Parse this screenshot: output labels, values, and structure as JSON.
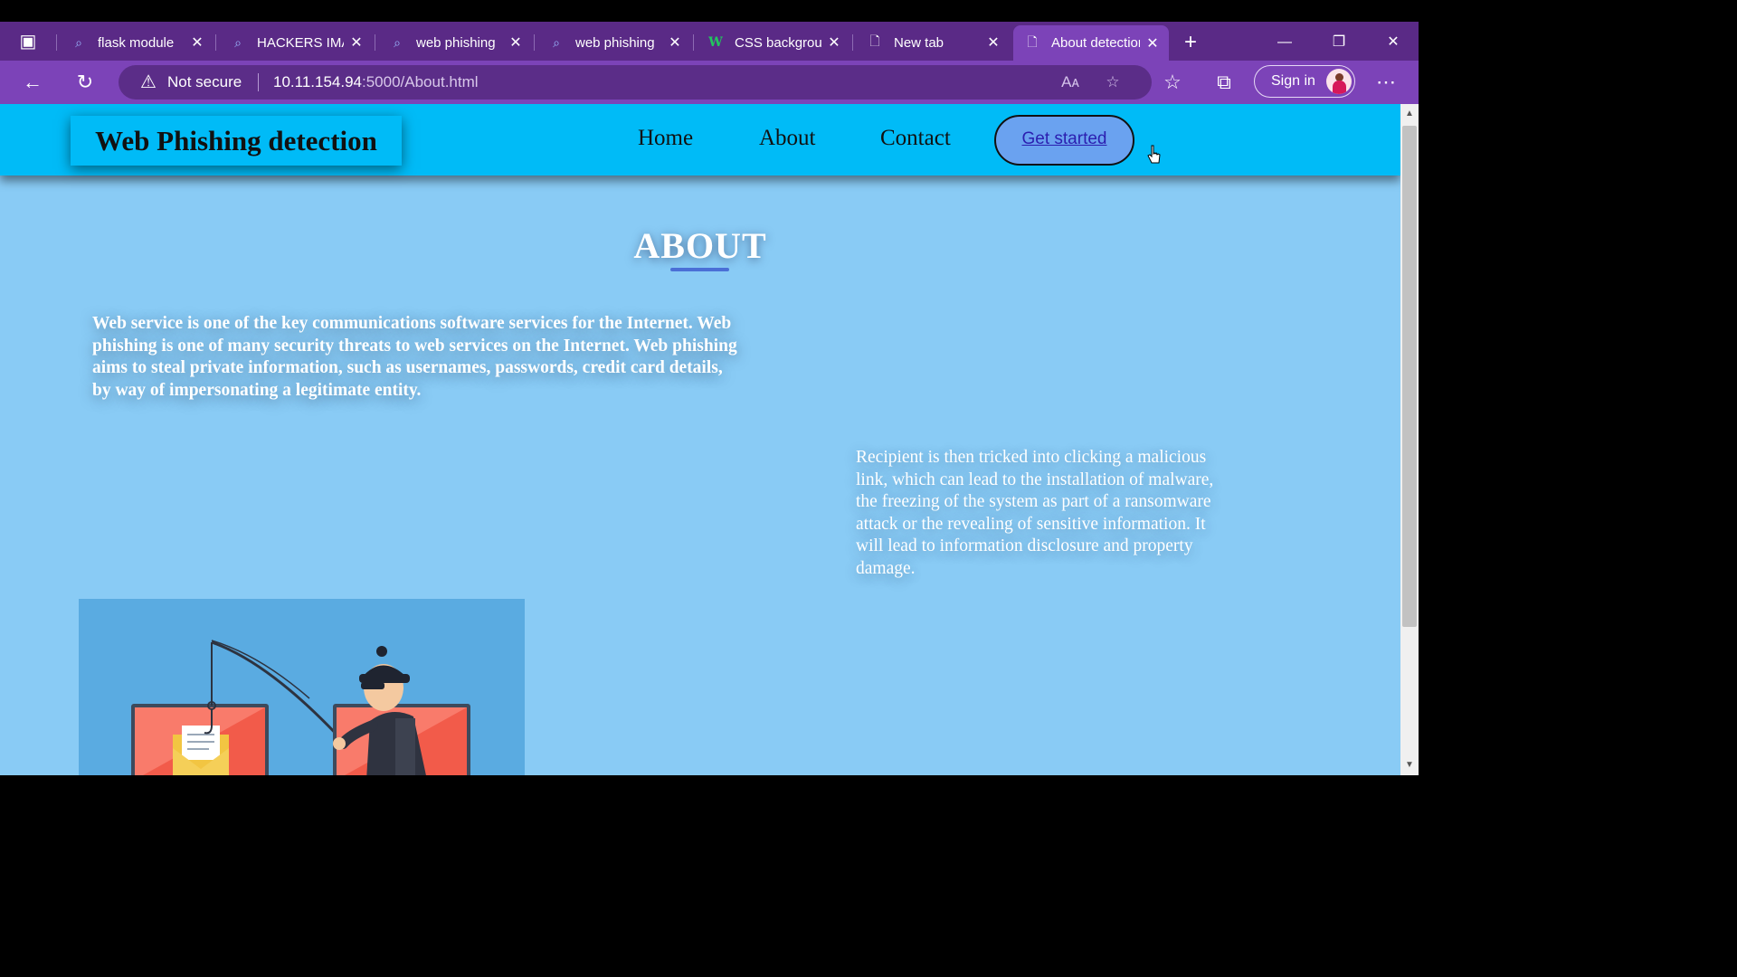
{
  "browser": {
    "tabs": [
      {
        "label": "flask module",
        "icon": "search-icon"
      },
      {
        "label": "HACKERS IMAGES",
        "icon": "search-icon"
      },
      {
        "label": "web phishing",
        "icon": "search-icon"
      },
      {
        "label": "web phishing",
        "icon": "search-icon"
      },
      {
        "label": "CSS background",
        "icon": "w3schools-icon"
      },
      {
        "label": "New tab",
        "icon": "document-icon"
      },
      {
        "label": "About detection",
        "icon": "document-icon",
        "active": true
      }
    ],
    "address": {
      "security_label": "Not secure",
      "host": "10.11.154.94",
      "path": ":5000/About.html"
    },
    "sign_in_label": "Sign in",
    "colors": {
      "tabbar": "#5a2a86",
      "toolbar": "#7c43b8"
    }
  },
  "site": {
    "logo": "Web Phishing detection",
    "nav": {
      "home": "Home",
      "about": "About",
      "contact": "Contact",
      "cta": "Get started"
    },
    "about_title": "ABOUT",
    "paragraph1": "Web service is one of the key communications software services for the Internet. Web phishing is one of many security threats to web services on the Internet. Web phishing aims to steal private information, such as usernames, passwords, credit card details, by way of impersonating a legitimate entity.",
    "paragraph2": "Recipient is then tricked into clicking a malicious link, which can lead to the installation of malware, the freezing of the system as part of a ransomware attack or the revealing of sensitive information. It will lead to information disclosure and property damage.",
    "colors": {
      "navbar": "#00bbf7",
      "background": "#89cbf5",
      "cta": "#6aa2f0"
    }
  }
}
